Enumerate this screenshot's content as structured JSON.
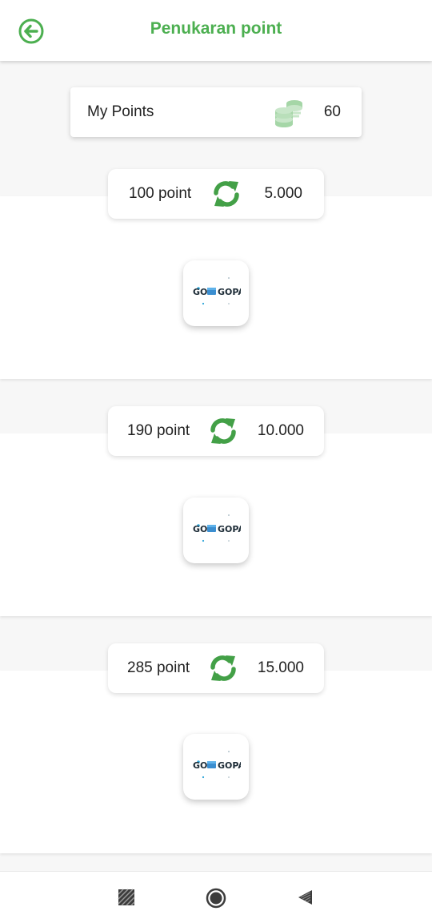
{
  "header": {
    "title": "Penukaran point",
    "back_icon": "arrow-left-circle-icon",
    "accent_color": "#4caf50"
  },
  "my_points": {
    "label": "My Points",
    "value": "60",
    "icon": "coins-stack-icon"
  },
  "offers": [
    {
      "points": "100 point",
      "amount": "5.000",
      "icon": "exchange-arrows-icon",
      "provider_logo": "GOPAY"
    },
    {
      "points": "190 point",
      "amount": "10.000",
      "icon": "exchange-arrows-icon",
      "provider_logo": "GOPAY"
    },
    {
      "points": "285 point",
      "amount": "15.000",
      "icon": "exchange-arrows-icon",
      "provider_logo": "GOPAY"
    }
  ],
  "nav_bar": {
    "items": [
      "recents-icon",
      "home-icon",
      "back-triangle-icon"
    ]
  }
}
